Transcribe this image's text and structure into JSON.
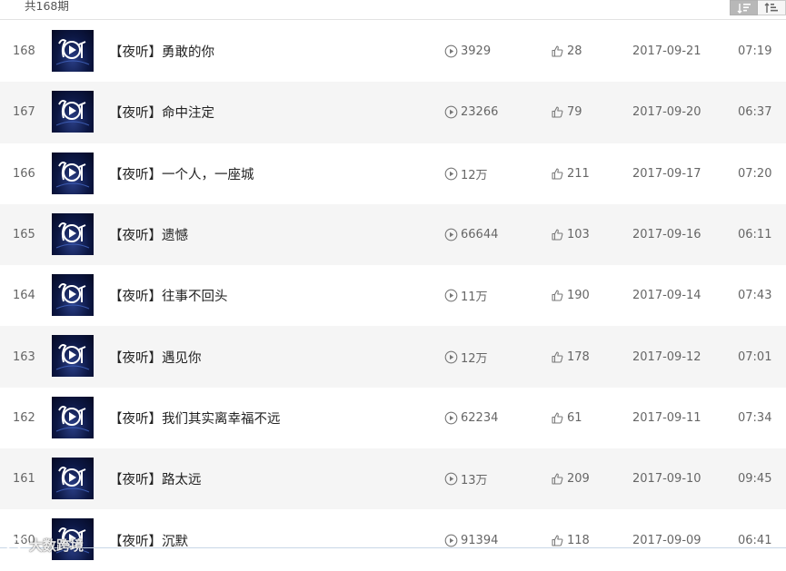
{
  "header": {
    "total_label": "共168期"
  },
  "sort": {
    "active_icon": "sort-ascending-icon",
    "inactive_icon": "sort-descending-icon"
  },
  "episodes": [
    {
      "num": "168",
      "title": "【夜听】勇敢的你",
      "plays": "3929",
      "likes": "28",
      "date": "2017-09-21",
      "duration": "07:19"
    },
    {
      "num": "167",
      "title": "【夜听】命中注定",
      "plays": "23266",
      "likes": "79",
      "date": "2017-09-20",
      "duration": "06:37"
    },
    {
      "num": "166",
      "title": "【夜听】一个人，一座城",
      "plays": "12万",
      "likes": "211",
      "date": "2017-09-17",
      "duration": "07:20"
    },
    {
      "num": "165",
      "title": "【夜听】遗憾",
      "plays": "66644",
      "likes": "103",
      "date": "2017-09-16",
      "duration": "06:11"
    },
    {
      "num": "164",
      "title": "【夜听】往事不回头",
      "plays": "11万",
      "likes": "190",
      "date": "2017-09-14",
      "duration": "07:43"
    },
    {
      "num": "163",
      "title": "【夜听】遇见你",
      "plays": "12万",
      "likes": "178",
      "date": "2017-09-12",
      "duration": "07:01"
    },
    {
      "num": "162",
      "title": "【夜听】我们其实离幸福不远",
      "plays": "62234",
      "likes": "61",
      "date": "2017-09-11",
      "duration": "07:34"
    },
    {
      "num": "161",
      "title": "【夜听】路太远",
      "plays": "13万",
      "likes": "209",
      "date": "2017-09-10",
      "duration": "09:45"
    },
    {
      "num": "160",
      "title": "【夜听】沉默",
      "plays": "91394",
      "likes": "118",
      "date": "2017-09-09",
      "duration": "06:41"
    }
  ],
  "watermark": {
    "text": "大数跨境",
    "icon": "watermark-logo-icon"
  },
  "colors": {
    "row_alt": "#f5f5f5",
    "text": "#222222",
    "meta": "#666666"
  }
}
